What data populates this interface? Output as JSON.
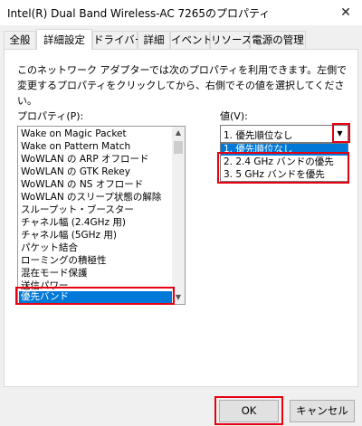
{
  "window": {
    "title": "Intel(R) Dual Band Wireless-AC 7265のプロパティ",
    "close_glyph": "✕"
  },
  "tabs": [
    {
      "label": "全般"
    },
    {
      "label": "詳細設定",
      "active": true
    },
    {
      "label": "ドライバー"
    },
    {
      "label": "詳細"
    },
    {
      "label": "イベント"
    },
    {
      "label": "リソース"
    },
    {
      "label": "電源の管理"
    }
  ],
  "description": "このネットワーク アダプターでは次のプロパティを利用できます。左側で変更するプロパティをクリックしてから、右側でその値を選択してください。",
  "properties": {
    "label": "プロパティ(P):",
    "items": [
      "Wake on Magic Packet",
      "Wake on Pattern Match",
      "WoWLAN の ARP オフロード",
      "WoWLAN の GTK Rekey",
      "WoWLAN の NS オフロード",
      "WoWLAN のスリープ状態の解除",
      "スループット・ブースター",
      "チャネル幅 (2.4GHz 用)",
      "チャネル幅 (5GHz 用)",
      "パケット結合",
      "ローミングの積極性",
      "混在モード保護",
      "送信パワー",
      "優先バンド"
    ],
    "selected_index": 13
  },
  "value": {
    "label": "値(V):",
    "current": "1. 優先順位なし",
    "options": [
      "1. 優先順位なし",
      "2. 2.4 GHz バンドの優先",
      "3. 5 GHz バンドを優先"
    ],
    "highlighted_index": 0
  },
  "buttons": {
    "ok": "OK",
    "cancel": "キャンセル"
  },
  "colors": {
    "selection": "#0078d7",
    "highlight_box": "#e60012"
  }
}
